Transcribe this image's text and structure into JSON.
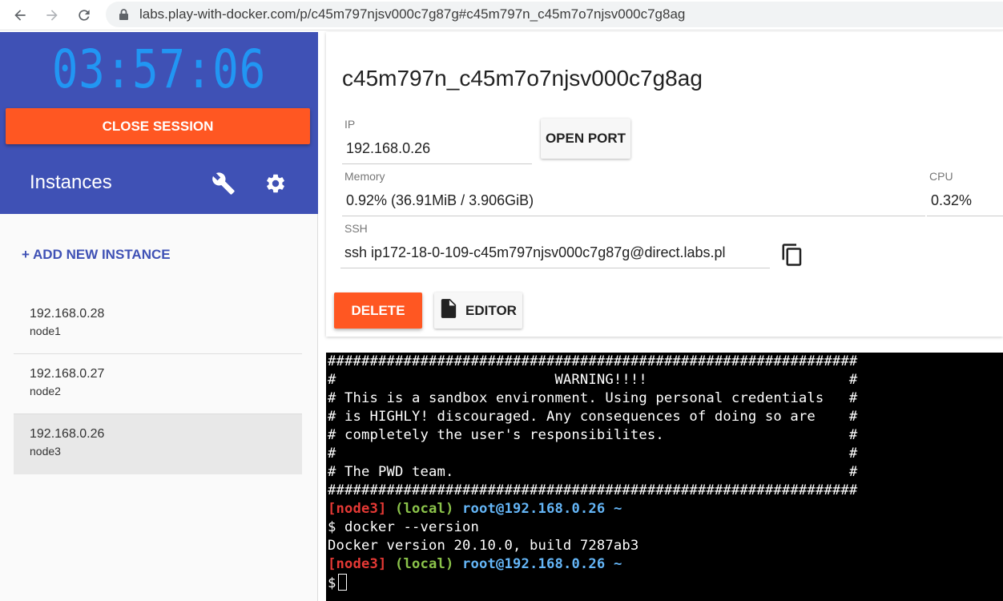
{
  "browser": {
    "url": "labs.play-with-docker.com/p/c45m797njsv000c7g87g#c45m797n_c45m7o7njsv000c7g8ag"
  },
  "sidebar": {
    "timer": "03:57:06",
    "close_session_label": "CLOSE SESSION",
    "instances_title": "Instances",
    "add_instance_label": "+ ADD NEW INSTANCE",
    "instances": [
      {
        "ip": "192.168.0.28",
        "name": "node1",
        "selected": false
      },
      {
        "ip": "192.168.0.27",
        "name": "node2",
        "selected": false
      },
      {
        "ip": "192.168.0.26",
        "name": "node3",
        "selected": true
      }
    ]
  },
  "details": {
    "hostname": "c45m797n_c45m7o7njsv000c7g8ag",
    "ip_label": "IP",
    "ip_value": "192.168.0.26",
    "open_port_label": "OPEN PORT",
    "memory_label": "Memory",
    "memory_value": "0.92% (36.91MiB / 3.906GiB)",
    "cpu_label": "CPU",
    "cpu_value": "0.32%",
    "ssh_label": "SSH",
    "ssh_value": "ssh ip172-18-0-109-c45m797njsv000c7g87g@direct.labs.pl",
    "delete_label": "DELETE",
    "editor_label": "EDITOR"
  },
  "terminal": {
    "banner": [
      "###############################################################",
      "#                          WARNING!!!!                        #",
      "# This is a sandbox environment. Using personal credentials   #",
      "# is HIGHLY! discouraged. Any consequences of doing so are    #",
      "# completely the user's responsibilites.                      #",
      "#                                                             #",
      "# The PWD team.                                               #",
      "###############################################################"
    ],
    "prompt_node": "[node3]",
    "prompt_local": "(local)",
    "prompt_host": "root@192.168.0.26",
    "prompt_tilde": "~",
    "command": "$ docker --version",
    "output": "Docker version 20.10.0, build 7287ab3",
    "final_prompt": "$"
  },
  "colors": {
    "sidebar_header": "#3f51b5",
    "timer": "#2196f3",
    "accent_orange": "#ff5722",
    "terminal_bg": "#000000"
  }
}
